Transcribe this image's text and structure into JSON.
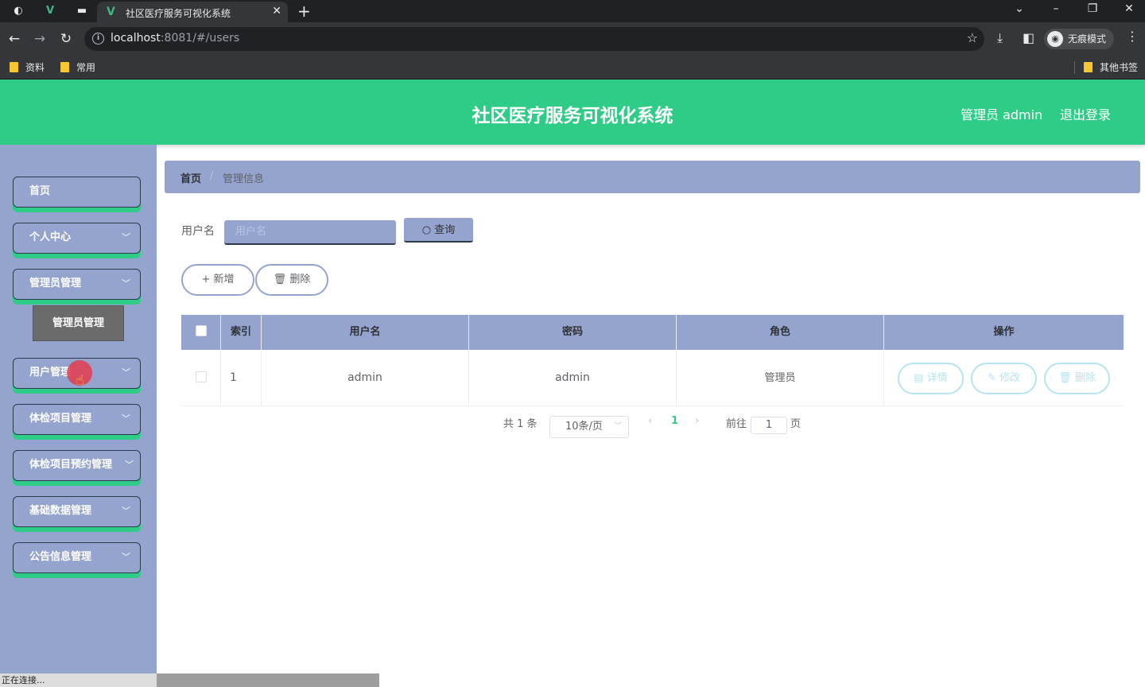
{
  "browser": {
    "tab_title": "社区医疗服务可视化系统",
    "url_host": "localhost",
    "url_rest": ":8081/#/users",
    "incognito_label": "无痕模式",
    "bookmarks": [
      "资料",
      "常用"
    ],
    "other_bookmarks": "其他书签"
  },
  "header": {
    "title": "社区医疗服务可视化系统",
    "user": "管理员 admin",
    "logout": "退出登录"
  },
  "sidebar": {
    "items": [
      {
        "label": "首页",
        "has_arrow": false
      },
      {
        "label": "个人中心",
        "has_arrow": true
      },
      {
        "label": "管理员管理",
        "has_arrow": true
      },
      {
        "label": "用户管理",
        "has_arrow": true
      },
      {
        "label": "体检项目管理",
        "has_arrow": true
      },
      {
        "label": "体检项目预约管理",
        "has_arrow": true
      },
      {
        "label": "基础数据管理",
        "has_arrow": true
      },
      {
        "label": "公告信息管理",
        "has_arrow": true
      }
    ],
    "submenu_label": "管理员管理"
  },
  "breadcrumb": {
    "home": "首页",
    "separator": "/",
    "current": "管理信息"
  },
  "search": {
    "label": "用户名",
    "placeholder": "用户名",
    "button": "查询"
  },
  "actions": {
    "add": "新增",
    "delete": "删除"
  },
  "table": {
    "columns": [
      "索引",
      "用户名",
      "密码",
      "角色",
      "操作"
    ],
    "rows": [
      {
        "index": "1",
        "username": "admin",
        "password": "admin",
        "role": "管理员"
      }
    ],
    "row_actions": {
      "detail": "详情",
      "edit": "修改",
      "delete": "删除"
    }
  },
  "pagination": {
    "total": "共 1 条",
    "page_size": "10条/页",
    "current_page": "1",
    "goto_prefix": "前往",
    "goto_value": "1",
    "goto_suffix": "页"
  },
  "status_bar": {
    "text": "正在连接..."
  },
  "colors": {
    "header_green": "#2ecc87",
    "sidebar_blue": "#94a4cf",
    "active_page": "#2ecc87"
  }
}
